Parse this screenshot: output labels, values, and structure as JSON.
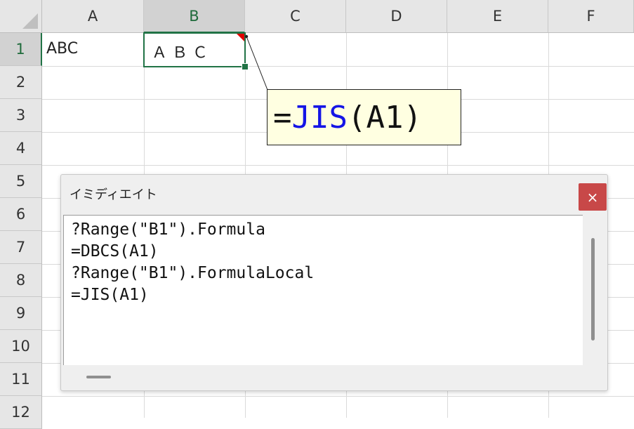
{
  "columns": [
    "A",
    "B",
    "C",
    "D",
    "E",
    "F"
  ],
  "rows": [
    "1",
    "2",
    "3",
    "4",
    "5",
    "6",
    "7",
    "8",
    "9",
    "10",
    "11",
    "12"
  ],
  "cells": {
    "A1": "ABC",
    "B1": "Ａ Ｂ Ｃ"
  },
  "comment": {
    "prefix": "=",
    "function": "JIS",
    "args": "(A1)"
  },
  "immediate_window": {
    "title": "イミディエイト",
    "close_symbol": "×",
    "lines": [
      "?Range(\"B1\").Formula",
      "=DBCS(A1)",
      "?Range(\"B1\").FormulaLocal",
      "=JIS(A1)"
    ]
  },
  "colors": {
    "selection": "#217346",
    "function_name": "#1515e6",
    "comment_bg": "#ffffe1",
    "close_button": "#c84848"
  }
}
